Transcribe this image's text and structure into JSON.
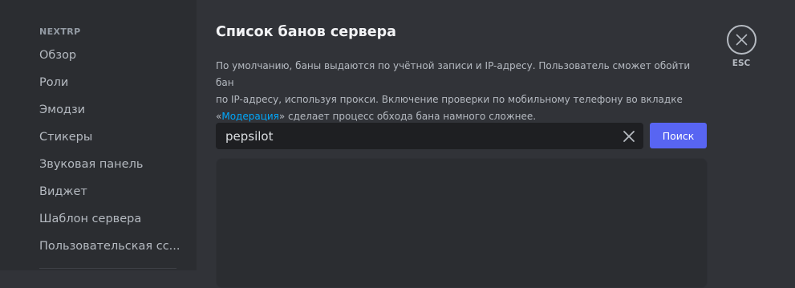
{
  "sidebar": {
    "header": "NEXTRP",
    "items": [
      {
        "label": "Обзор"
      },
      {
        "label": "Роли"
      },
      {
        "label": "Эмодзи"
      },
      {
        "label": "Стикеры"
      },
      {
        "label": "Звуковая панель"
      },
      {
        "label": "Виджет"
      },
      {
        "label": "Шаблон сервера"
      },
      {
        "label": "Пользовательская сс..."
      }
    ]
  },
  "main": {
    "title": "Список банов сервера",
    "description": {
      "line1": "По умолчанию, баны выдаются по учётной записи и IP-адресу. Пользователь сможет обойти бан",
      "line2": "по IP-адресу, используя прокси. Включение проверки по мобильному телефону во вкладке",
      "line3_prefix": "«",
      "line3_link": "Модерация",
      "line3_suffix": "» сделает процесс обхода бана намного сложнее."
    },
    "search": {
      "value": "pepsilot",
      "placeholder": ""
    },
    "search_button_label": "Поиск"
  },
  "close": {
    "esc_label": "ESC"
  },
  "colors": {
    "accent": "#5865f2",
    "link": "#00a8fc",
    "background": "#313338",
    "sidebar_background": "#2b2d31"
  },
  "icons": {
    "clear": "close-icon",
    "close": "close-circle-icon"
  }
}
